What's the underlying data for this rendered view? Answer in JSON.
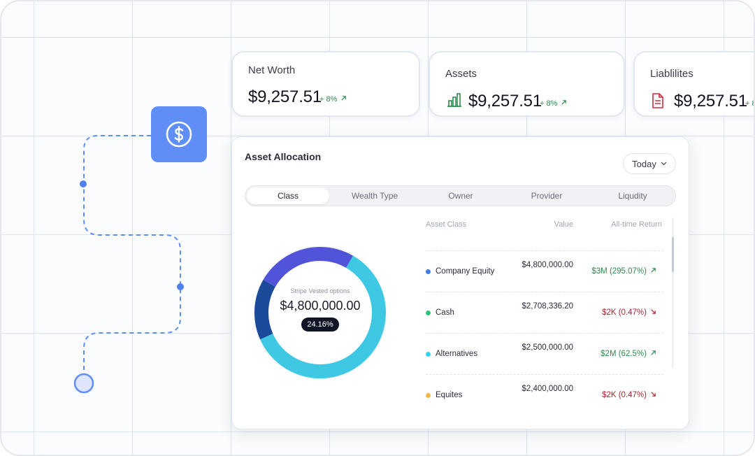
{
  "colors": {
    "accent": "#5f8ef6",
    "positive": "#2f8a4d",
    "negative": "#b5212f",
    "donut_teal": "#3ec8e3",
    "donut_navy": "#1b4a9a",
    "donut_indigo": "#5153d8"
  },
  "icons": {
    "dollar_tile": "dollar-circle-icon",
    "assets": "bar-chart-icon",
    "liabilities": "document-icon",
    "up": "arrow-up-right-icon",
    "down": "arrow-down-right-icon",
    "dropdown": "chevron-down-icon"
  },
  "cards": {
    "net_worth": {
      "label": "Net Worth",
      "value": "$9,257.51",
      "change": "+ 8%"
    },
    "assets": {
      "label": "Assets",
      "value": "$9,257.51",
      "change": "+ 8%"
    },
    "liabilities": {
      "label": "Liablilites",
      "value": "$9,257.51",
      "change": "+ 8"
    }
  },
  "allocation": {
    "title": "Asset Allocation",
    "period": "Today",
    "tabs": [
      "Class",
      "Wealth Type",
      "Owner",
      "Provider",
      "Liqudity"
    ],
    "active_tab": "Class",
    "donut": {
      "caption": "Stripe Vested options",
      "amount": "$4,800,000.00",
      "percent": "24.16%",
      "segments": [
        {
          "name": "Stripe Vested options",
          "share": 0.6,
          "color": "#3ec8e3"
        },
        {
          "name": "Navy segment",
          "share": 0.15,
          "color": "#1b4a9a"
        },
        {
          "name": "Indigo segment",
          "share": 0.25,
          "color": "#5153d8"
        }
      ]
    },
    "table": {
      "headers": {
        "asset_class": "Asset Class",
        "value": "Value",
        "return": "All-time Return"
      },
      "rows": [
        {
          "name": "Company Equity",
          "dot": "#3f7ee8",
          "value": "$4,800,000.00",
          "return": "$3M (295.07%)",
          "direction": "up"
        },
        {
          "name": "Cash",
          "dot": "#2fc47a",
          "value": "$2,708,336.20",
          "return": "$2K (0.47%)",
          "direction": "down"
        },
        {
          "name": "Alternatives",
          "dot": "#36d2ee",
          "value": "$2,500,000.00",
          "return": "$2M (62.5%)",
          "direction": "up"
        },
        {
          "name": "Equites",
          "dot": "#f5b74a",
          "value": "$2,400,000.00",
          "return": "$2K (0.47%)",
          "direction": "down"
        }
      ]
    }
  }
}
